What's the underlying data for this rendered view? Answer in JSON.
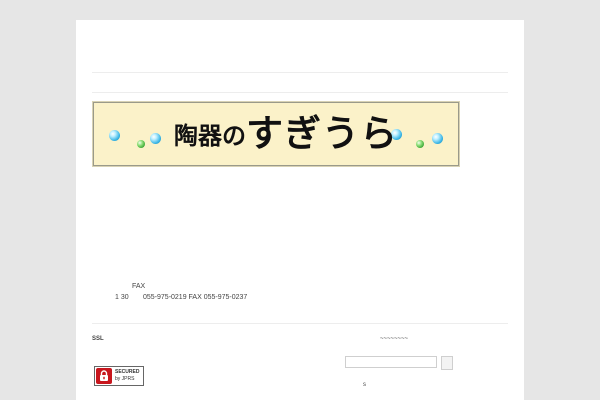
{
  "banner": {
    "text_part1": "陶器",
    "text_part2": "の",
    "text_part3": "すぎうら",
    "bead_colors": {
      "blue": "#3bb6e6",
      "green": "#2f9e2a"
    }
  },
  "contact": {
    "fax_label": "FAX",
    "hours": "1 30",
    "phone_fax": "055-975-0219 FAX 055-975-0237"
  },
  "footer": {
    "left_label": "SSL",
    "right_label": "~~~~~~~~",
    "search": {
      "value": "",
      "placeholder": ""
    },
    "bottom_char": "s",
    "seal": {
      "line1": "SECURED",
      "line2": "by JPRS",
      "color": "#c8161d"
    }
  }
}
